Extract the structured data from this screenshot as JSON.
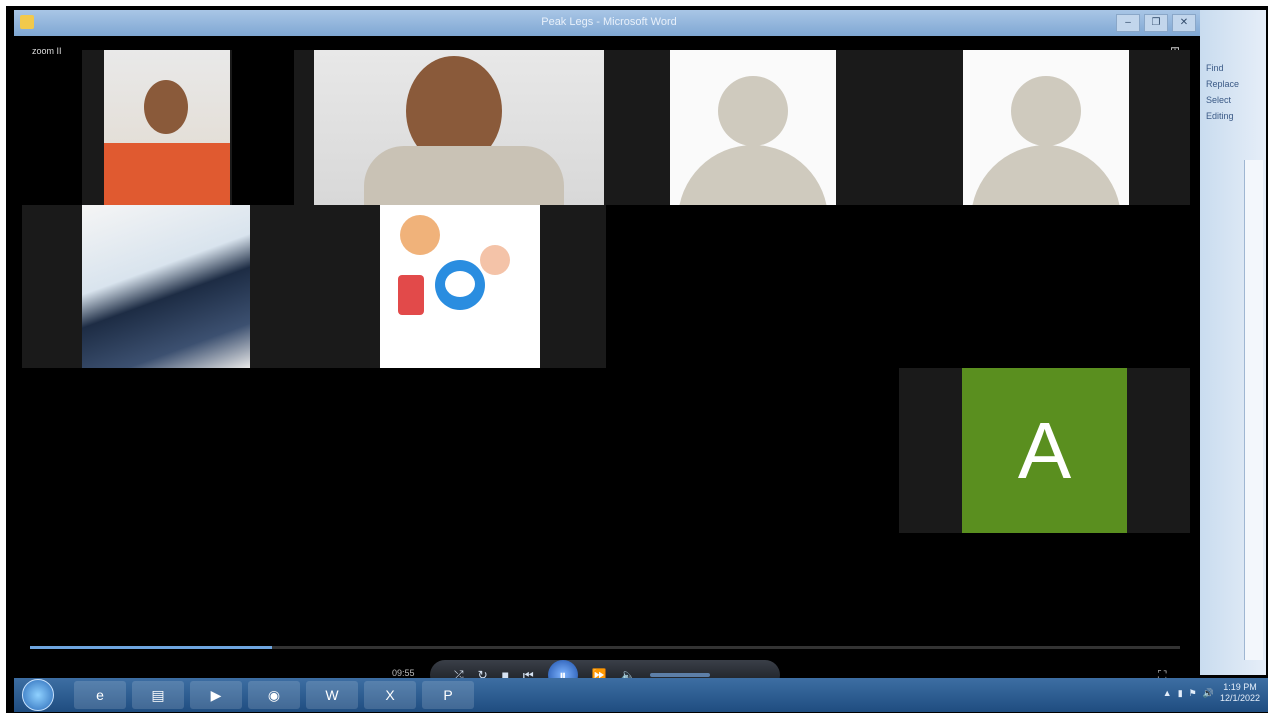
{
  "window": {
    "title": "Peak Legs - Microsoft Word",
    "minimize_glyph": "–",
    "restore_glyph": "❐",
    "close_glyph": "✕"
  },
  "side_panel": {
    "items": [
      "Find",
      "Replace",
      "Select",
      "Editing"
    ]
  },
  "meeting": {
    "label": "zoom II",
    "view_icon": "gallery-view-icon",
    "participant_initial": "A"
  },
  "player": {
    "progress_fraction": 0.21,
    "time_text": "09:55",
    "buttons": {
      "prev_label": "⏮",
      "stop_label": "■",
      "rewind_label": "⏪",
      "play_pause_label": "⏸",
      "forward_label": "⏩",
      "mute_label": "🔈",
      "fullscreen_label": "⛶"
    },
    "accent": "#6fa6e0"
  },
  "taskbar": {
    "apps": [
      {
        "name": "internet-explorer-icon",
        "label": "e"
      },
      {
        "name": "file-explorer-icon",
        "label": "▤"
      },
      {
        "name": "media-player-icon",
        "label": "▶"
      },
      {
        "name": "chrome-icon",
        "label": "◉"
      },
      {
        "name": "word-icon",
        "label": "W"
      },
      {
        "name": "excel-icon",
        "label": "X"
      },
      {
        "name": "powerpoint-icon",
        "label": "P"
      }
    ],
    "clock_time": "1:19 PM",
    "clock_date": "12/1/2022"
  },
  "colors": {
    "green_tile": "#5a8f1f",
    "taskbar": "#1f4d80"
  }
}
